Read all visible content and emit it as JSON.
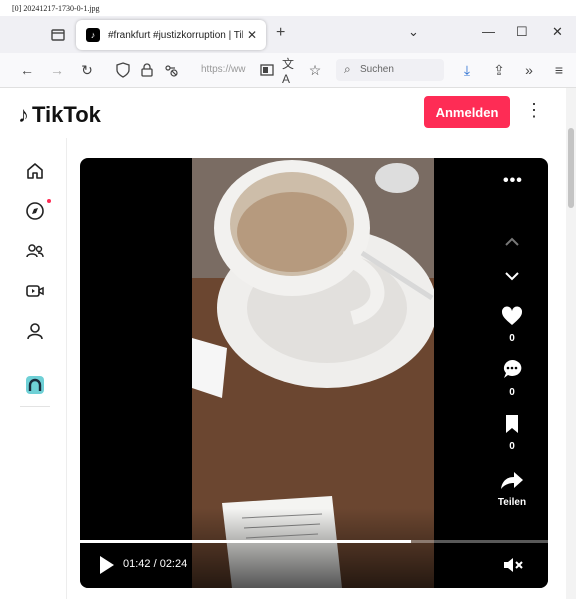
{
  "caption": "[0] 20241217-1730-0-1.jpg",
  "browser": {
    "tab_title": "#frankfurt #justizkorruption | TikTok",
    "url_text": "https://ww",
    "search_placeholder": "Suchen"
  },
  "page": {
    "brand": "TikTok",
    "login_label": "Anmelden"
  },
  "video": {
    "time": "01:42 / 02:24",
    "progress": 0.708,
    "likes": "0",
    "comments": "0",
    "saves": "0",
    "share_label": "Teilen"
  },
  "colors": {
    "accent": "#fe2c55",
    "video_bg": "#000000"
  }
}
